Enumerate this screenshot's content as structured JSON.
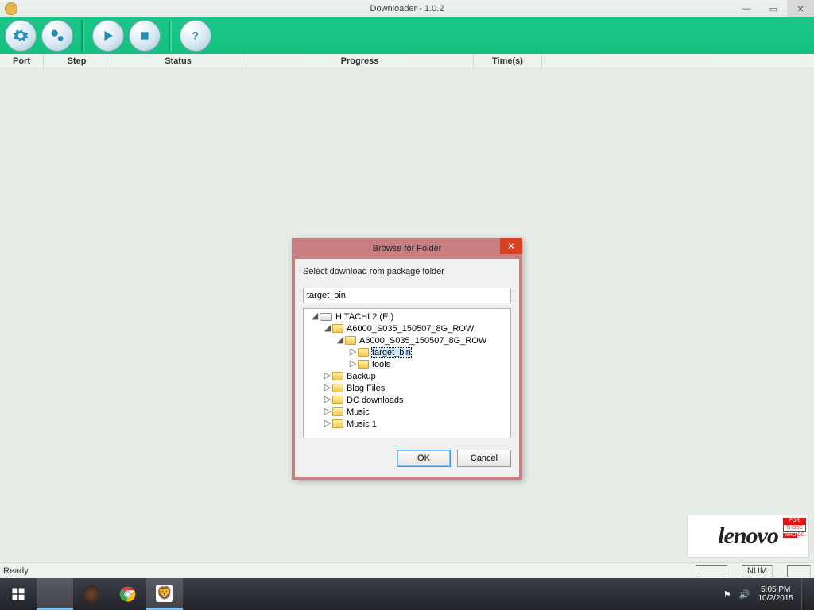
{
  "window": {
    "title": "Downloader - 1.0.2"
  },
  "columns": {
    "port": "Port",
    "step": "Step",
    "status": "Status",
    "progress": "Progress",
    "time": "Time(s)"
  },
  "dialog": {
    "title": "Browse for Folder",
    "prompt": "Select download rom package folder",
    "value": "target_bin",
    "ok": "OK",
    "cancel": "Cancel",
    "tree": {
      "drive": "HITACHI 2 (E:)",
      "pkg_outer": "A6000_S035_150507_8G_ROW",
      "pkg_inner": "A6000_S035_150507_8G_ROW",
      "target": "target_bin",
      "tools": "tools",
      "backup": "Backup",
      "blog": "Blog Files",
      "dcdl": "DC downloads",
      "music": "Music",
      "music1": "Music 1"
    }
  },
  "status": {
    "ready": "Ready",
    "num": "NUM"
  },
  "logo": {
    "brand": "lenovo",
    "for": "FOR",
    "those": "THOSE",
    "who": "WHO",
    "do": "DO."
  },
  "tray": {
    "time": "5:05 PM",
    "date": "10/2/2015"
  }
}
